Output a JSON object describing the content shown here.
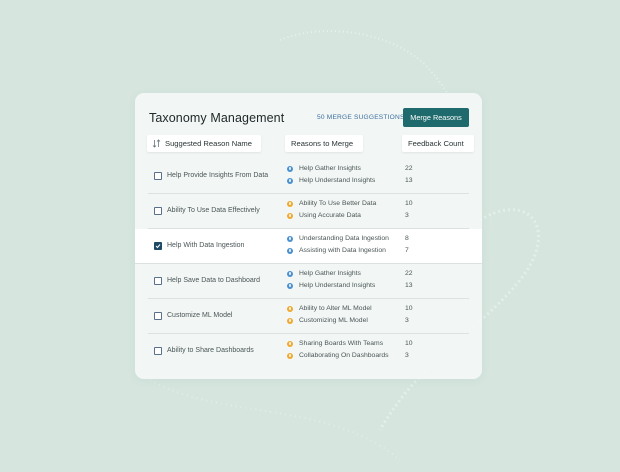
{
  "header": {
    "title": "Taxonomy Management",
    "merge_suggestions": "50 MERGE SUGGESTIONS",
    "merge_button": "Merge Reasons"
  },
  "columns": {
    "name": "Suggested Reason Name",
    "reasons": "Reasons to Merge",
    "count": "Feedback Count"
  },
  "colors": {
    "accent": "#1f6a6d",
    "link": "#3d6f9e",
    "dot_blue": "#4a8fd0",
    "dot_orange": "#f0a830"
  },
  "rows": [
    {
      "name": "Help Provide Insights From Data",
      "checked": false,
      "reasons": [
        {
          "label": "Help Gather Insights",
          "count": "22",
          "dot": "blue"
        },
        {
          "label": "Help Understand Insights",
          "count": "13",
          "dot": "blue"
        }
      ]
    },
    {
      "name": "Ability To Use Data Effectively",
      "checked": false,
      "reasons": [
        {
          "label": "Ability To Use Better Data",
          "count": "10",
          "dot": "orange"
        },
        {
          "label": "Using Accurate Data",
          "count": "3",
          "dot": "orange"
        }
      ]
    },
    {
      "name": "Help With Data Ingestion",
      "checked": true,
      "reasons": [
        {
          "label": "Understanding Data Ingestion",
          "count": "8",
          "dot": "blue"
        },
        {
          "label": "Assisting with Data Ingestion",
          "count": "7",
          "dot": "blue"
        }
      ]
    },
    {
      "name": "Help Save Data to Dashboard",
      "checked": false,
      "reasons": [
        {
          "label": "Help Gather Insights",
          "count": "22",
          "dot": "blue"
        },
        {
          "label": "Help Understand Insights",
          "count": "13",
          "dot": "blue"
        }
      ]
    },
    {
      "name": "Customize ML Model",
      "checked": false,
      "reasons": [
        {
          "label": "Ability to Alter ML Model",
          "count": "10",
          "dot": "orange"
        },
        {
          "label": "Customizing ML Model",
          "count": "3",
          "dot": "orange"
        }
      ]
    },
    {
      "name": "Ability to Share Dashboards",
      "checked": false,
      "reasons": [
        {
          "label": "Sharing Boards With Teams",
          "count": "10",
          "dot": "orange"
        },
        {
          "label": "Collaborating On Dashboards",
          "count": "3",
          "dot": "orange"
        }
      ]
    }
  ]
}
